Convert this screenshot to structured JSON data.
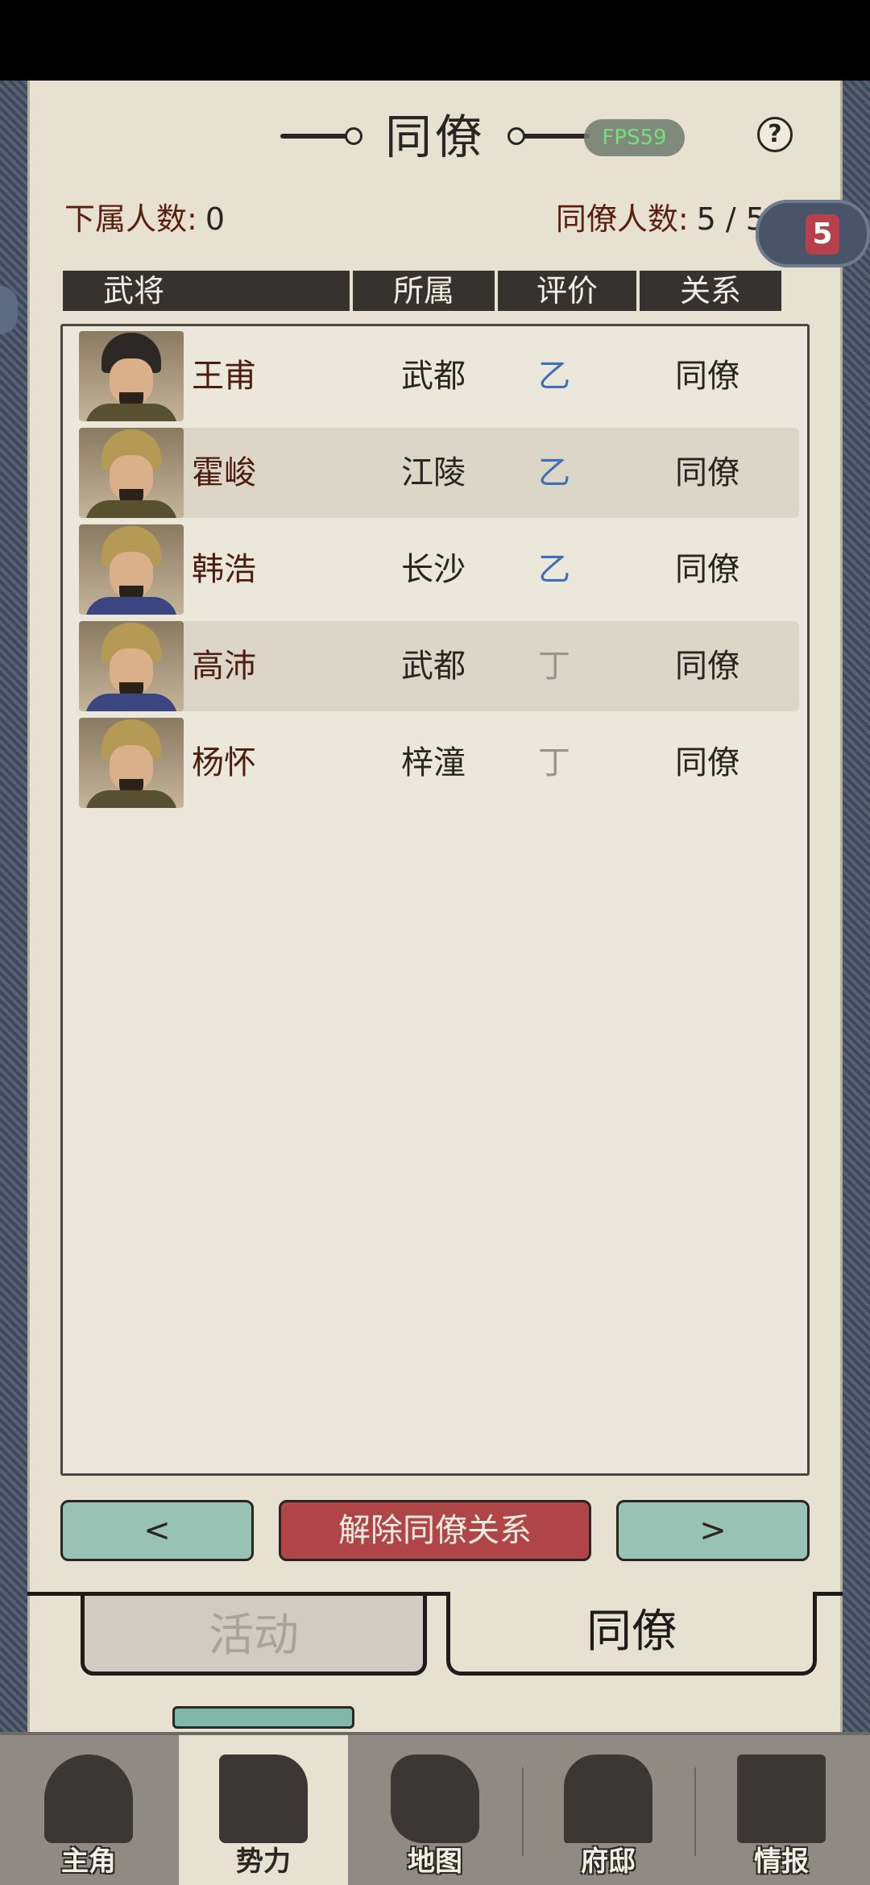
{
  "title": "同僚",
  "fps": "FPS59",
  "help_label": "?",
  "counts": {
    "subordinate_label": "下属人数:",
    "subordinate_value": "0",
    "colleague_label": "同僚人数:",
    "colleague_value": "5 / 5"
  },
  "badge": "5",
  "columns": [
    "武将",
    "所属",
    "评价",
    "关系"
  ],
  "rows": [
    {
      "name": "王甫",
      "affiliation": "武都",
      "rating": "乙",
      "relation": "同僚"
    },
    {
      "name": "霍峻",
      "affiliation": "江陵",
      "rating": "乙",
      "relation": "同僚"
    },
    {
      "name": "韩浩",
      "affiliation": "长沙",
      "rating": "乙",
      "relation": "同僚"
    },
    {
      "name": "高沛",
      "affiliation": "武都",
      "rating": "丁",
      "relation": "同僚"
    },
    {
      "name": "杨怀",
      "affiliation": "梓潼",
      "rating": "丁",
      "relation": "同僚"
    }
  ],
  "buttons": {
    "prev": "<",
    "dissolve": "解除同僚关系",
    "next": ">"
  },
  "tabs": {
    "activity": "活动",
    "colleague": "同僚"
  },
  "nav": [
    "主角",
    "势力",
    "地图",
    "府邸",
    "情报"
  ],
  "colors": {
    "accent": "#b04548",
    "nav_button": "#98c2b3",
    "rating_good": "#3f6fb8",
    "rating_low": "#9a948a"
  }
}
